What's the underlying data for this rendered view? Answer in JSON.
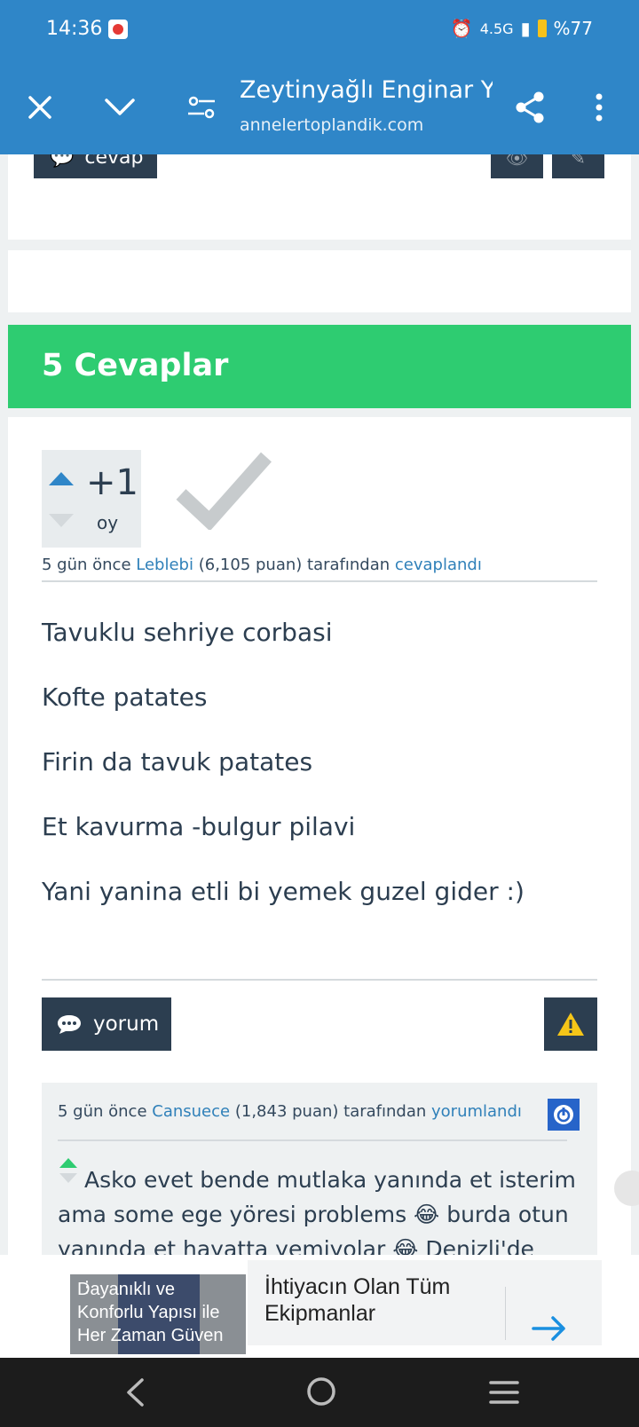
{
  "status": {
    "time": "14:36",
    "network": "4.5G",
    "battery": "%77"
  },
  "toolbar": {
    "title": "Zeytinyağlı Enginar Y...",
    "url": "annelertoplandik.com"
  },
  "question_actions": {
    "answer_label": "cevap"
  },
  "answers_header": "5 Cevaplar",
  "answer": {
    "votes": "+1",
    "votes_label": "oy",
    "meta_prefix": "5 gün önce",
    "author": "Leblebi",
    "points": "(6,105 puan) tarafından",
    "action": "cevaplandı",
    "lines": [
      "Tavuklu sehriye corbasi",
      "Kofte patates",
      "Firin da tavuk patates",
      "Et kavurma -bulgur pilavi",
      "Yani yanina etli bi yemek guzel gider :)"
    ],
    "comment_button": "yorum"
  },
  "comment": {
    "meta_prefix": "5 gün önce",
    "author": "Cansuece",
    "points": "(1,843 puan) tarafından",
    "action": "yorumlandı",
    "text": "Asko evet bende mutlaka yanında et isterim ama some ege yöresi problems 😂 burda otun yanında et hayatta yemiyolar 😂 Denizli'de"
  },
  "ad": {
    "image_text": "Dayanıklı ve Konforlu Yapısı ile Her Zaman Güven",
    "headline": "İhtiyacın Olan Tüm Ekipmanlar"
  },
  "colors": {
    "header_blue": "#2f86c8",
    "band_green": "#2ecc71",
    "dark_button": "#2c3e50",
    "link_blue": "#2f80b9"
  }
}
